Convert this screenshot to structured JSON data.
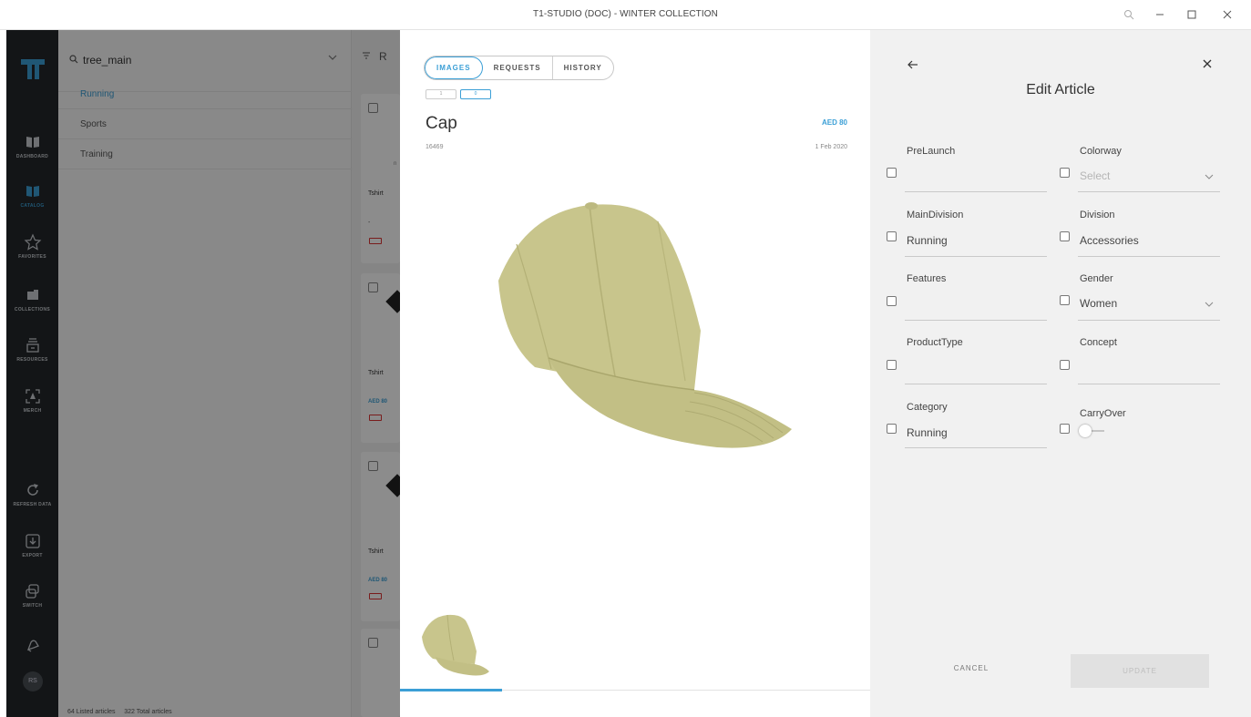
{
  "window": {
    "title": "T1-STUDIO (DOC) - WINTER COLLECTION",
    "controls": [
      "zoom-icon",
      "minimize-icon",
      "maximize-icon",
      "close-icon"
    ]
  },
  "leftnav": {
    "items": [
      {
        "label": "DASHBOARD",
        "icon": "dashboard-icon"
      },
      {
        "label": "CATALOG",
        "icon": "catalog-icon",
        "active": true
      },
      {
        "label": "FAVORITES",
        "icon": "star-icon"
      },
      {
        "label": "COLLECTIONS",
        "icon": "collections-icon"
      },
      {
        "label": "RESOURCES",
        "icon": "resources-icon"
      },
      {
        "label": "MERCH",
        "icon": "merch-icon"
      },
      {
        "label": "REFRESH DATA",
        "icon": "refresh-icon"
      },
      {
        "label": "EXPORT",
        "icon": "export-icon"
      },
      {
        "label": "SWITCH",
        "icon": "switch-icon"
      }
    ],
    "avatar": "RS"
  },
  "tree": {
    "search_value": "tree_main",
    "items": [
      "Running",
      "Sports",
      "Training"
    ]
  },
  "grid": {
    "cards": [
      {
        "name": "Tshirt",
        "price": "",
        "subtitle": "-"
      },
      {
        "name": "Tshirt",
        "price": "AED 80",
        "subtitle": ""
      },
      {
        "name": "Tshirt",
        "price": "AED 80",
        "subtitle": ""
      }
    ]
  },
  "status": {
    "listed": "64 Listed articles",
    "total": "322 Total articles"
  },
  "article": {
    "tabs": [
      "IMAGES",
      "REQUESTS",
      "HISTORY"
    ],
    "active_tab": "IMAGES",
    "mini_pills": [
      "1",
      "0"
    ],
    "name": "Cap",
    "price": "AED 80",
    "number": "16469",
    "date": "1 Feb 2020"
  },
  "edit": {
    "title": "Edit Article",
    "fields": [
      {
        "label": "PreLaunch",
        "value": ""
      },
      {
        "label": "Colorway",
        "value": "Select",
        "placeholder": true,
        "dropdown": true
      },
      {
        "label": "MainDivision",
        "value": "Running"
      },
      {
        "label": "Division",
        "value": "Accessories"
      },
      {
        "label": "Features",
        "value": ""
      },
      {
        "label": "Gender",
        "value": "Women",
        "dropdown": true
      },
      {
        "label": "ProductType",
        "value": ""
      },
      {
        "label": "Concept",
        "value": ""
      },
      {
        "label": "Category",
        "value": "Running"
      },
      {
        "label": "CarryOver",
        "toggle": false
      }
    ],
    "cancel_label": "CANCEL",
    "update_label": "UPDATE"
  },
  "colors": {
    "accent": "#3b9fd6",
    "nav_bg": "#23272b",
    "cap": "#c8c58c"
  }
}
